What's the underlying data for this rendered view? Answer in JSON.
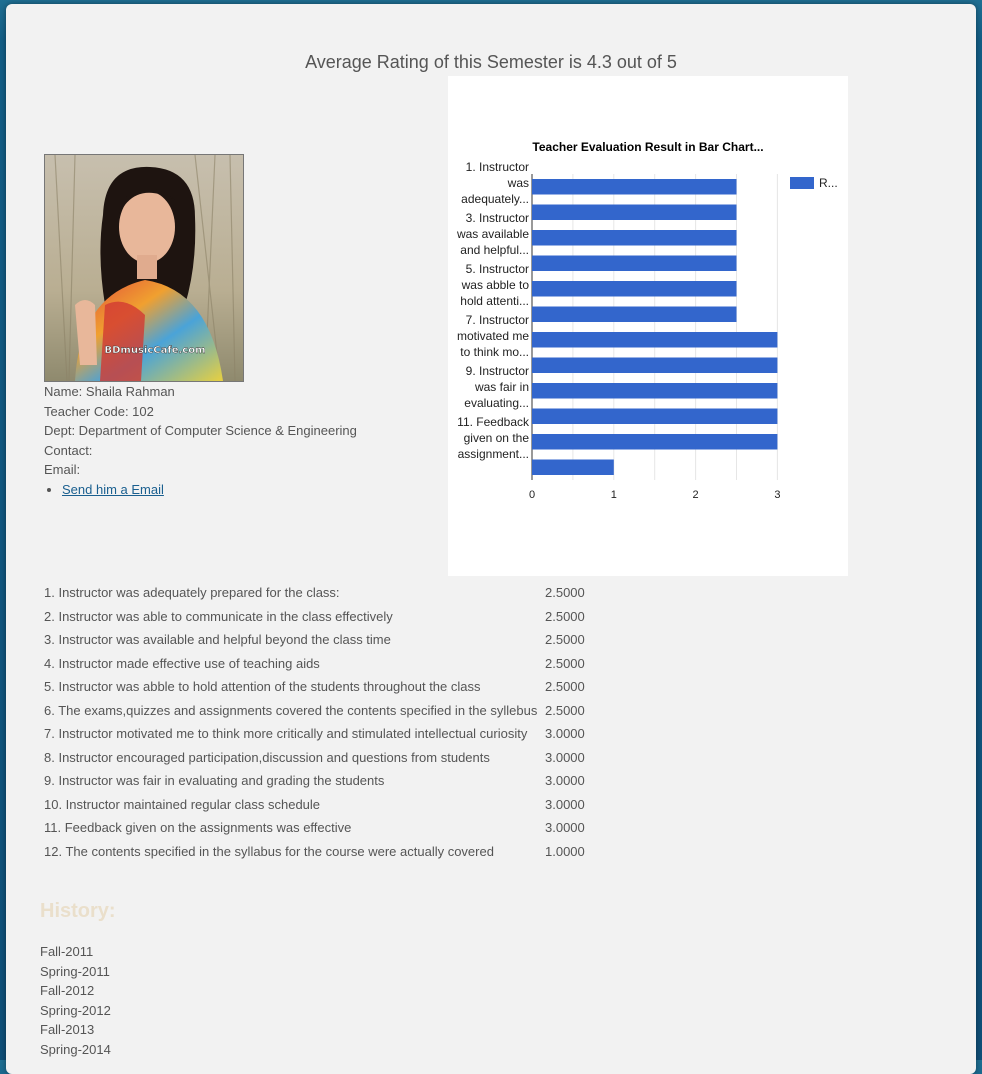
{
  "headline": "Average Rating of this Semester is 4.3 out of 5",
  "photo": {
    "watermark": "BDmusicCafe.com"
  },
  "teacher": {
    "name": "Name: Shaila Rahman",
    "code": "Teacher Code: 102",
    "dept": "Dept: Department of Computer Science & Engineering",
    "contact": "Contact:",
    "email": "Email:",
    "email_link": "Send him a Email"
  },
  "questions": [
    {
      "q": "1. Instructor was adequately prepared for the class:",
      "v": "2.5000"
    },
    {
      "q": "2. Instructor was able to communicate in the class effectively",
      "v": "2.5000"
    },
    {
      "q": "3. Instructor was available and helpful beyond the class time",
      "v": "2.5000"
    },
    {
      "q": "4. Instructor made effective use of teaching aids",
      "v": "2.5000"
    },
    {
      "q": "5. Instructor was abble to hold attention of the students throughout the class",
      "v": "2.5000"
    },
    {
      "q": "6. The exams,quizzes and assignments covered the contents specified in the syllebus",
      "v": "2.5000"
    },
    {
      "q": "7. Instructor motivated me to think more critically and stimulated intellectual curiosity",
      "v": "3.0000"
    },
    {
      "q": "8. Instructor encouraged participation,discussion and questions from students",
      "v": "3.0000"
    },
    {
      "q": "9. Instructor was fair in evaluating and grading the students",
      "v": "3.0000"
    },
    {
      "q": "10. Instructor maintained regular class schedule",
      "v": "3.0000"
    },
    {
      "q": "11. Feedback given on the assignments was effective",
      "v": "3.0000"
    },
    {
      "q": "12. The contents specified in the syllabus for the course were actually covered",
      "v": "1.0000"
    }
  ],
  "history": {
    "title": "History:",
    "items": [
      "Fall-2011",
      "Spring-2011",
      "Fall-2012",
      "Spring-2012",
      "Fall-2013",
      "Spring-2014"
    ]
  },
  "chart_data": {
    "type": "bar",
    "orientation": "horizontal",
    "title": "Teacher Evaluation Result in Bar Chart...",
    "legend": "R...",
    "legend_position": "right",
    "bar_color": "#3366cc",
    "grid": true,
    "xlim": [
      0,
      3
    ],
    "xticks": [
      "0",
      "1",
      "2",
      "3"
    ],
    "category_labels": [
      {
        "index": 0,
        "lines": [
          "1. Instructor",
          "was",
          "adequately..."
        ]
      },
      {
        "index": 2,
        "lines": [
          "3. Instructor",
          "was available",
          "and helpful..."
        ]
      },
      {
        "index": 4,
        "lines": [
          "5. Instructor",
          "was abble to",
          "hold attenti..."
        ]
      },
      {
        "index": 6,
        "lines": [
          "7. Instructor",
          "motivated me",
          "to think mo..."
        ]
      },
      {
        "index": 8,
        "lines": [
          "9. Instructor",
          "was fair in",
          "evaluating..."
        ]
      },
      {
        "index": 10,
        "lines": [
          "11. Feedback",
          "given on the",
          "assignment..."
        ]
      }
    ],
    "values": [
      2.5,
      2.5,
      2.5,
      2.5,
      2.5,
      2.5,
      3,
      3,
      3,
      3,
      3,
      1
    ]
  }
}
